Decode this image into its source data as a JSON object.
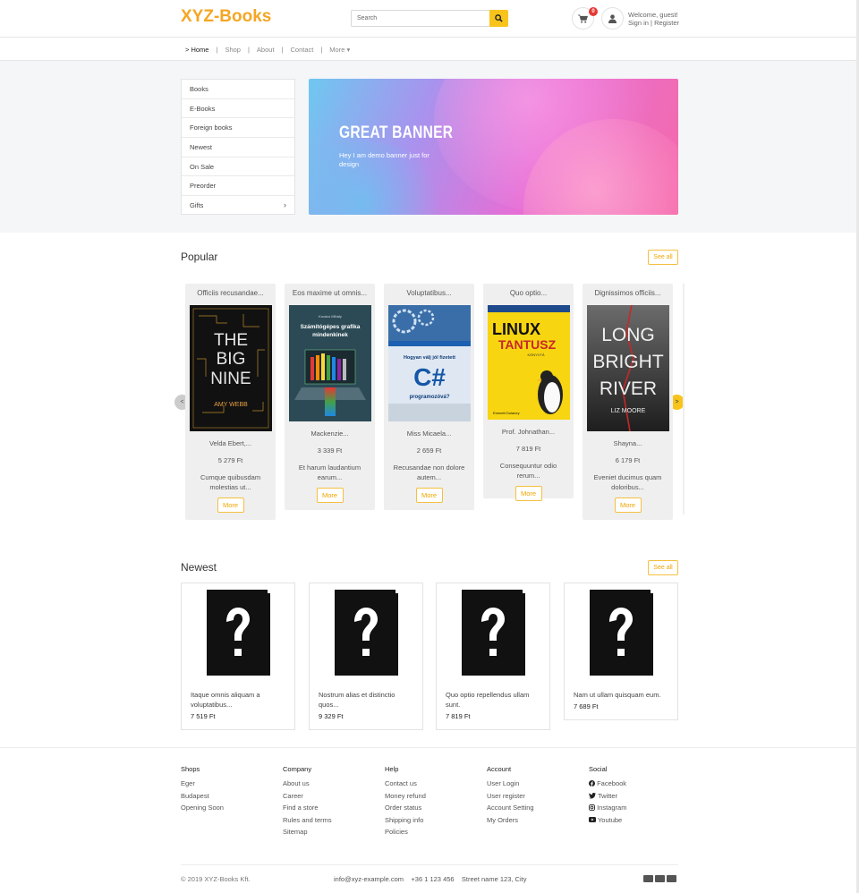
{
  "header": {
    "logo": "XYZ-Books",
    "search_placeholder": "Search",
    "cart_count": "0",
    "welcome": "Welcome, guest!",
    "sign_in": "Sign in",
    "register": "Register",
    "separator": "|"
  },
  "nav": {
    "items": [
      "> Home",
      "Shop",
      "About",
      "Contact",
      "More ▾"
    ]
  },
  "categories": [
    "Books",
    "E-Books",
    "Foreign books",
    "Newest",
    "On Sale",
    "Preorder",
    "Gifts"
  ],
  "banner": {
    "title": "GREAT BANNER",
    "text": "Hey I am demo banner just for design"
  },
  "popular": {
    "title": "Popular",
    "see_all": "See all",
    "prev": "<",
    "next": ">",
    "books": [
      {
        "title": "Officiis recusandae...",
        "author": "Velda Ebert,...",
        "price": "5 279 Ft",
        "desc": "Cumque quibusdam molestias ut...",
        "more": "More",
        "cover": {
          "lines": [
            "THE",
            "BIG",
            "NINE"
          ],
          "sub": "AMY WEBB",
          "bg": "#111111",
          "fg": "#e6e6e6"
        }
      },
      {
        "title": "Eos maxime ut omnis...",
        "author": "Mackenzie...",
        "price": "3 339 Ft",
        "desc": "Et harum laudantium earum...",
        "more": "More",
        "cover": {
          "lines": [
            "Számítógépes grafika",
            "mindenkinek"
          ],
          "sub": "Kovács Mihály",
          "bg": "#2c4a55",
          "fg": "#ffffff"
        }
      },
      {
        "title": "Voluptatibus...",
        "author": "Miss Micaela...",
        "price": "2 659 Ft",
        "desc": "Recusandae non dolore autem...",
        "more": "More",
        "cover": {
          "lines": [
            "Hogyan válj jól fizetett",
            "C#",
            "programozóvá?"
          ],
          "sub": "",
          "bg": "#dfe8f2",
          "fg": "#1457a8"
        }
      },
      {
        "title": "Quo optio...",
        "author": "Prof. Johnathan...",
        "price": "7 819 Ft",
        "desc": "Consequuntur odio rerum...",
        "more": "More",
        "cover": {
          "lines": [
            "LINUX",
            "TANTUSZ",
            "KÖNYVTÁ"
          ],
          "sub": "Emmett Dulaney",
          "bg": "#f7d511",
          "fg": "#222222"
        }
      },
      {
        "title": "Dignissimos officiis...",
        "author": "Shayna...",
        "price": "6 179 Ft",
        "desc": "Eveniet ducimus quam doloribus...",
        "more": "More",
        "cover": {
          "lines": [
            "LONG",
            "BRIGHT",
            "RIVER"
          ],
          "sub": "LIZ MOORE",
          "bg": "#3c3c3c",
          "fg": "#f0f0f0"
        }
      }
    ]
  },
  "newest": {
    "title": "Newest",
    "see_all": "See all",
    "books": [
      {
        "title": "Itaque omnis aliquam a voluptatibus...",
        "price": "7 519 Ft"
      },
      {
        "title": "Nostrum alias et distinctio quos...",
        "price": "9 329 Ft"
      },
      {
        "title": "Quo optio repellendus ullam sunt.",
        "price": "7 819 Ft"
      },
      {
        "title": "Nam ut ullam quisquam eum.",
        "price": "7 689 Ft"
      }
    ]
  },
  "footer": {
    "columns": [
      {
        "title": "Shops",
        "items": [
          "Eger",
          "Budapest",
          "Opening Soon"
        ]
      },
      {
        "title": "Company",
        "items": [
          "About us",
          "Career",
          "Find a store",
          "Rules and terms",
          "Sitemap"
        ]
      },
      {
        "title": "Help",
        "items": [
          "Contact us",
          "Money refund",
          "Order status",
          "Shipping info",
          "Policies"
        ]
      },
      {
        "title": "Account",
        "items": [
          "User Login",
          "User register",
          "Account Setting",
          "My Orders"
        ]
      },
      {
        "title": "Social",
        "items": [
          "Facebook",
          "Twitter",
          "Instagram",
          "Youtube"
        ]
      }
    ],
    "copyright": "© 2019 XYZ-Books Kft.",
    "email": "info@xyz-example.com",
    "phone": "+36 1 123 456",
    "address": "Street name 123, City"
  },
  "colors": {
    "accent": "#f5a623",
    "button": "#f8c41c",
    "badge": "#e53935"
  }
}
